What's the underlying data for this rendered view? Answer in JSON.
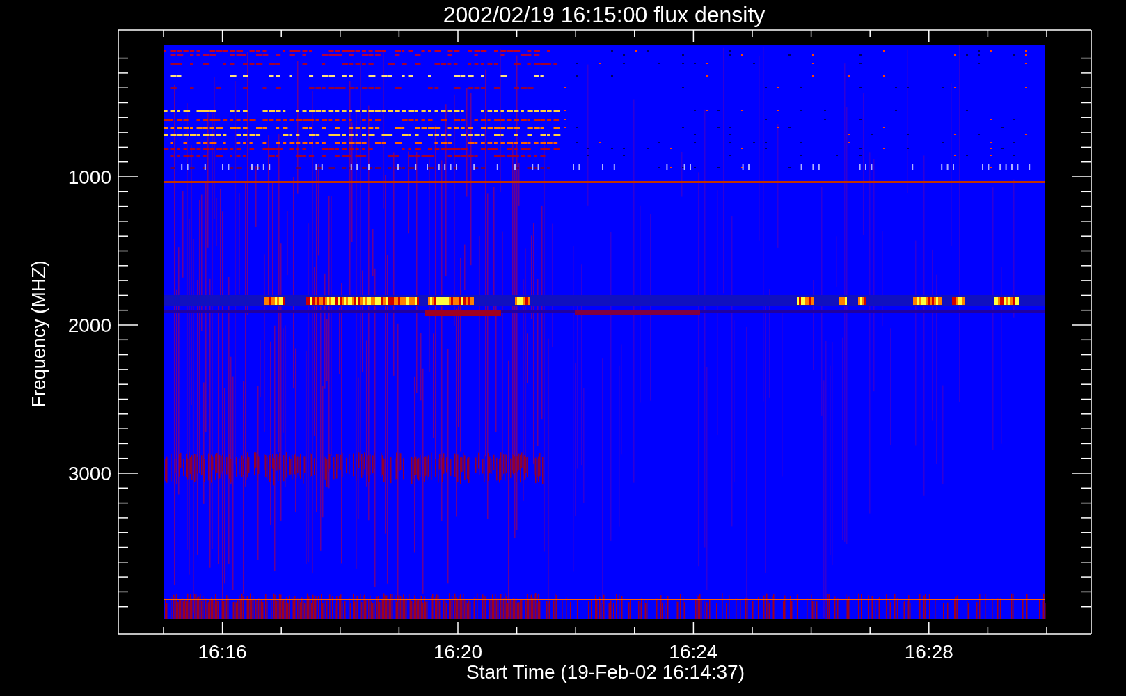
{
  "title": "2002/02/19 16:15:00 flux density",
  "y_axis": {
    "label": "Frequency (MHZ)",
    "ticks": [
      "1000",
      "2000",
      "3000"
    ]
  },
  "x_axis": {
    "label": "Start Time (19-Feb-02 16:14:37)",
    "ticks": [
      "16:16",
      "16:20",
      "16:24",
      "16:28"
    ]
  }
}
